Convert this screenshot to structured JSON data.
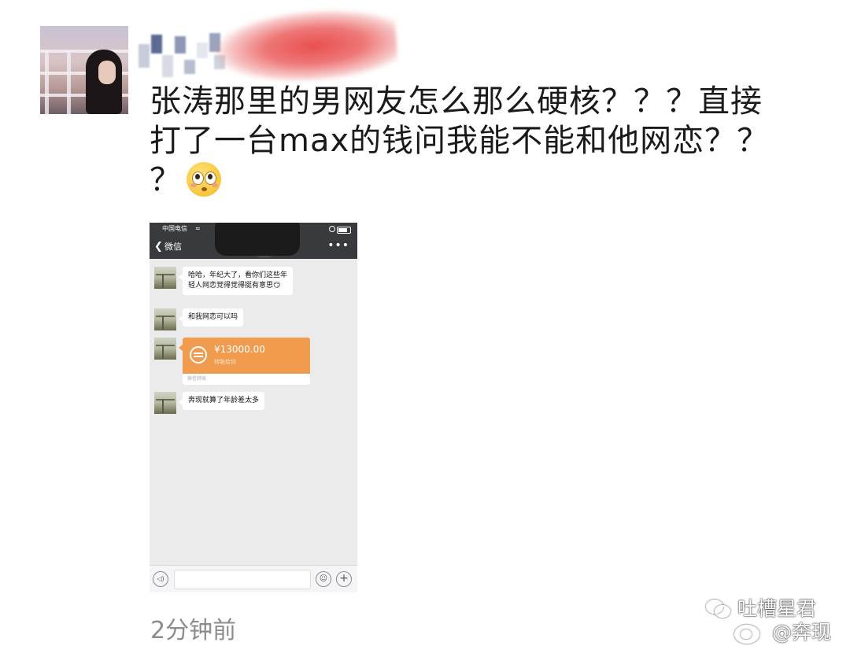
{
  "post": {
    "line1": "张涛那里的男网友怎么那么硬核？？？直接",
    "line2": "打了一台max的钱问我能不能和他网恋？？",
    "line3": "？",
    "emoji": "flushed-face",
    "time": "2分钟前"
  },
  "phone": {
    "status": {
      "carrier": "中国电信"
    },
    "nav": {
      "back_icon": "chevron-left-icon",
      "back_label": "微信",
      "more_icon": "ellipsis-icon",
      "more_label": "•••"
    },
    "messages": [
      {
        "type": "text",
        "lines": [
          "哈哈，年纪大了，看你们这些年",
          "轻人网恋觉得觉得挺有意思😏"
        ]
      },
      {
        "type": "text",
        "lines": [
          "和我网恋可以吗"
        ]
      },
      {
        "type": "transfer",
        "amount": "¥13000.00",
        "note": "转账给你",
        "footer": "微信转账"
      },
      {
        "type": "text",
        "lines": [
          "奔现就算了年龄差太多"
        ]
      }
    ],
    "input": {
      "voice_icon": "voice-icon",
      "voice_glyph": "◁)",
      "emoji_icon": "smile-icon",
      "emoji_glyph": "☺",
      "plus_icon": "plus-icon",
      "plus_glyph": "+"
    }
  },
  "watermark": {
    "line1": "吐槽星君",
    "line2": "@奔现"
  },
  "colors": {
    "wechat_nav": "#393a3e",
    "chat_bg": "#ebebeb",
    "transfer": "#f19b4f",
    "post_text": "#1a1a1a",
    "time_text": "#8c8c8c",
    "scribble": "#e84646"
  }
}
